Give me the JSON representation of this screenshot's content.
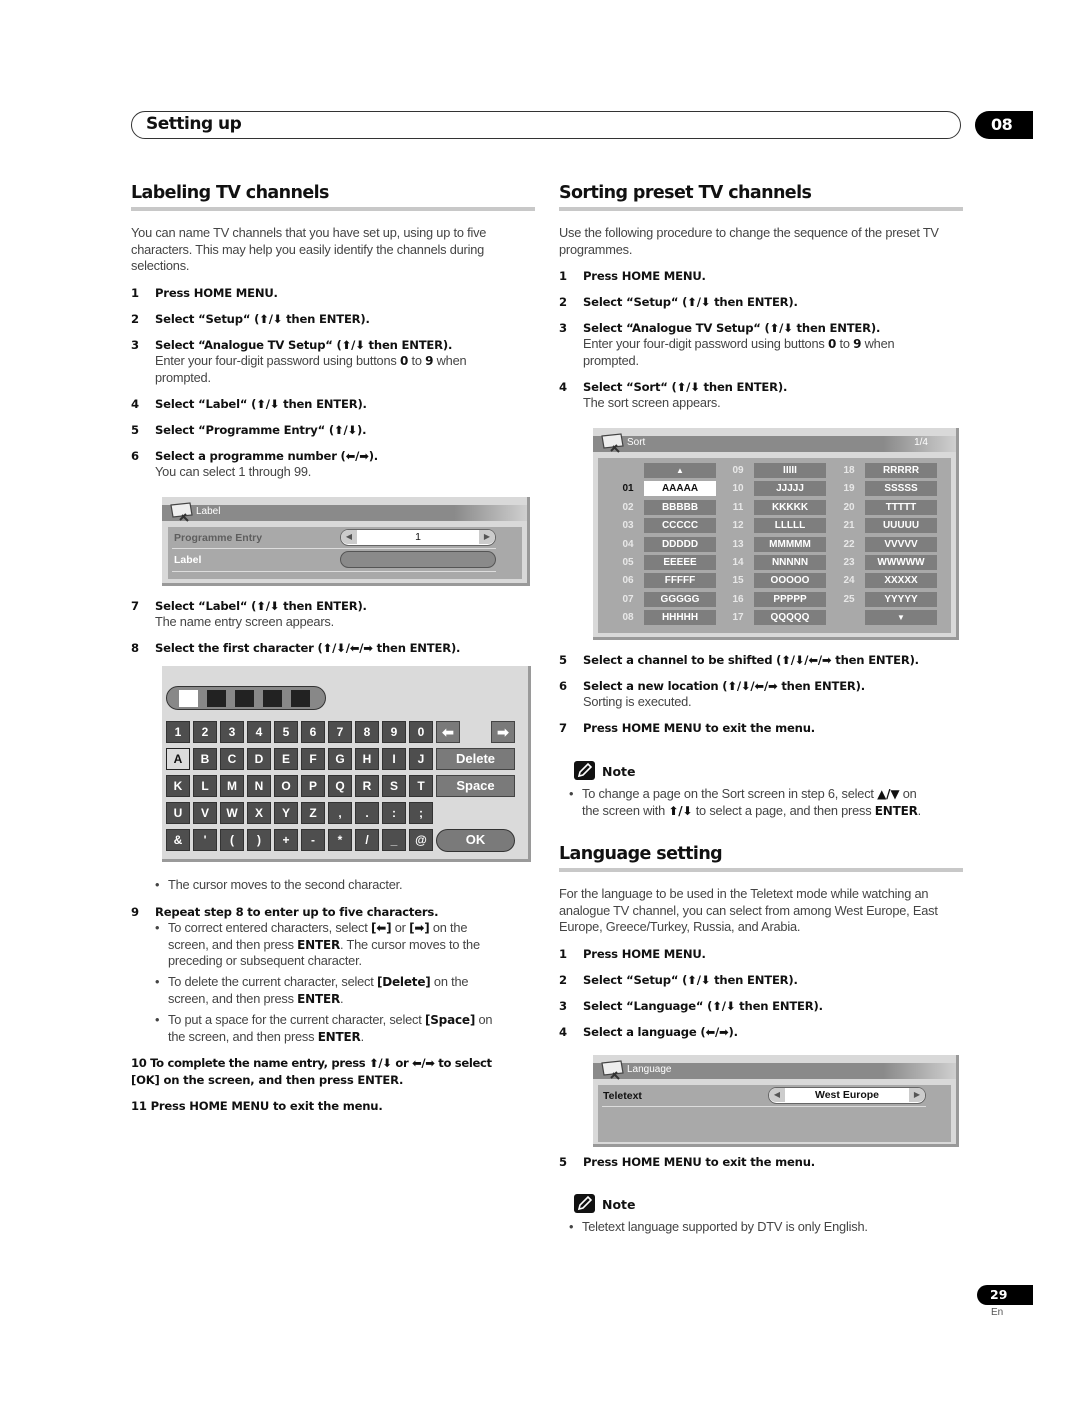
{
  "header": {
    "section_title": "Setting up",
    "chapter_number": "08"
  },
  "labeling": {
    "title": "Labeling TV channels",
    "intro": "You can name TV channels that you have set up, using up to five characters. This may help you easily identify the channels during selections.",
    "steps": [
      {
        "n": "1",
        "text": "Press HOME MENU."
      },
      {
        "n": "2",
        "text": "Select “Setup“ (⬆/⬇ then ENTER)."
      },
      {
        "n": "3",
        "text": "Select “Analogue TV Setup“ (⬆/⬇ then ENTER)."
      },
      {
        "n": "4",
        "text": "Select “Label“ (⬆/⬇ then ENTER)."
      },
      {
        "n": "5",
        "text": "Select “Programme Entry“ (⬆/⬇)."
      },
      {
        "n": "6",
        "text": "Select a programme number (⬅/➡)."
      },
      {
        "n": "7",
        "text": "Select “Label“ (⬆/⬇ then ENTER)."
      },
      {
        "n": "8",
        "text": "Select the first character (⬆/⬇/⬅/➡ then ENTER)."
      },
      {
        "n": "9",
        "text": "Repeat step 8 to enter up to five characters."
      },
      {
        "n": "10",
        "text": "To complete the name entry, press ⬆/⬇ or ⬅/➡ to select"
      },
      {
        "n": "",
        "text": "[OK] on the screen, and then press ENTER."
      },
      {
        "n": "11",
        "text": "Press HOME MENU to exit the menu."
      }
    ],
    "step3_sub_a": "Enter your four-digit password using buttons ",
    "step3_sub_b": "0",
    "step3_sub_c": " to ",
    "step3_sub_d": "9",
    "step3_sub_e": " when",
    "step3_sub_f": "prompted.",
    "step6_sub": "You can select 1 through 99.",
    "step7_sub": "The name entry screen appears.",
    "step8_bullet": "The cursor moves to the second character.",
    "step9_bullets": [
      {
        "a": "To correct entered characters, select ",
        "b": "[⬅]",
        "c": " or ",
        "d": "[➡]",
        "e": " on the",
        "l2a": "screen, and then press ",
        "l2b": "ENTER",
        "l2c": ". The cursor moves to the",
        "l3": "preceding or subsequent character."
      },
      {
        "a": "To delete the current character, select ",
        "b": "[Delete]",
        "c": " on the",
        "l2a": "screen, and then press ",
        "l2b": "ENTER",
        "l2c": "."
      },
      {
        "a": "To put a space for the current character, select ",
        "b": "[Space]",
        "c": " on",
        "l2a": "the screen, and then press ",
        "l2b": "ENTER",
        "l2c": "."
      }
    ],
    "label_screen": {
      "title": "Label",
      "rows": [
        {
          "label": "Programme Entry",
          "value": "1"
        },
        {
          "label": "Label",
          "value": ""
        }
      ]
    },
    "keyboard": {
      "char_slots": 5,
      "active_slot": 0,
      "rows": [
        [
          "1",
          "2",
          "3",
          "4",
          "5",
          "6",
          "7",
          "8",
          "9",
          "0"
        ],
        [
          "A",
          "B",
          "C",
          "D",
          "E",
          "F",
          "G",
          "H",
          "I",
          "J"
        ],
        [
          "K",
          "L",
          "M",
          "N",
          "O",
          "P",
          "Q",
          "R",
          "S",
          "T"
        ],
        [
          "U",
          "V",
          "W",
          "X",
          "Y",
          "Z",
          ",",
          ".",
          ":",
          ";"
        ],
        [
          "&",
          "'",
          "(",
          ")",
          "+",
          "-",
          "*",
          "/",
          "_",
          "@"
        ]
      ],
      "selected_key": "A",
      "left_arrow": "🡄",
      "right_arrow": "🡆",
      "delete_label": "Delete",
      "space_label": "Space",
      "ok_label": "OK"
    }
  },
  "sorting": {
    "title": "Sorting preset TV channels",
    "intro": "Use the following procedure to change the sequence of the preset TV programmes.",
    "steps": [
      {
        "n": "1",
        "text": "Press HOME MENU."
      },
      {
        "n": "2",
        "text": "Select “Setup“ (⬆/⬇ then ENTER)."
      },
      {
        "n": "3",
        "text": "Select “Analogue TV Setup“ (⬆/⬇ then ENTER)."
      },
      {
        "n": "4",
        "text": "Select “Sort“ (⬆/⬇ then ENTER)."
      },
      {
        "n": "5",
        "text": "Select a channel to be shifted (⬆/⬇/⬅/➡ then ENTER)."
      },
      {
        "n": "6",
        "text": "Select a new location (⬆/⬇/⬅/➡ then ENTER)."
      },
      {
        "n": "7",
        "text": "Press HOME MENU to exit the menu."
      }
    ],
    "step3_sub_a": "Enter your four-digit password using buttons ",
    "step3_sub_b": "0",
    "step3_sub_c": " to ",
    "step3_sub_d": "9",
    "step3_sub_e": " when",
    "step3_sub_f": "prompted.",
    "step4_sub": "The sort screen appears.",
    "step6_sub": "Sorting is executed.",
    "sort_screen": {
      "title": "Sort",
      "page": "1/4",
      "up_arrow": "▲",
      "down_arrow": "▼",
      "columns": [
        [
          {
            "num": "",
            "name": "▲"
          },
          {
            "num": "01",
            "name": "AAAAA",
            "selected": true
          },
          {
            "num": "02",
            "name": "BBBBB"
          },
          {
            "num": "03",
            "name": "CCCCC"
          },
          {
            "num": "04",
            "name": "DDDDD"
          },
          {
            "num": "05",
            "name": "EEEEE"
          },
          {
            "num": "06",
            "name": "FFFFF"
          },
          {
            "num": "07",
            "name": "GGGGG"
          },
          {
            "num": "08",
            "name": "HHHHH"
          }
        ],
        [
          {
            "num": "09",
            "name": "IIIII"
          },
          {
            "num": "10",
            "name": "JJJJJ"
          },
          {
            "num": "11",
            "name": "KKKKK"
          },
          {
            "num": "12",
            "name": "LLLLL"
          },
          {
            "num": "13",
            "name": "MMMMM"
          },
          {
            "num": "14",
            "name": "NNNNN"
          },
          {
            "num": "15",
            "name": "OOOOO"
          },
          {
            "num": "16",
            "name": "PPPPP"
          },
          {
            "num": "17",
            "name": "QQQQQ"
          }
        ],
        [
          {
            "num": "18",
            "name": "RRRRR"
          },
          {
            "num": "19",
            "name": "SSSSS"
          },
          {
            "num": "20",
            "name": "TTTTT"
          },
          {
            "num": "21",
            "name": "UUUUU"
          },
          {
            "num": "22",
            "name": "VVVVV"
          },
          {
            "num": "23",
            "name": "WWWWW"
          },
          {
            "num": "24",
            "name": "XXXXX"
          },
          {
            "num": "25",
            "name": "YYYYY"
          },
          {
            "num": "",
            "name": "▼"
          }
        ]
      ]
    },
    "note": {
      "heading": "Note",
      "l1a": "To change a page on the Sort screen in step 6, select ",
      "l1b": "▲/▼",
      "l1c": " on",
      "l2a": "the screen with ",
      "l2b": "⬆/⬇",
      "l2c": " to select a page, and then press ",
      "l2d": "ENTER",
      "l2e": "."
    }
  },
  "language": {
    "title": "Language setting",
    "intro": "For the language to be used in the Teletext mode while watching an analogue TV channel, you can select from among West Europe, East Europe, Greece/Turkey, Russia, and Arabia.",
    "steps": [
      {
        "n": "1",
        "text": "Press HOME MENU."
      },
      {
        "n": "2",
        "text": "Select “Setup“ (⬆/⬇ then ENTER)."
      },
      {
        "n": "3",
        "text": "Select “Language“ (⬆/⬇ then ENTER)."
      },
      {
        "n": "4",
        "text": "Select a language (⬅/➡)."
      },
      {
        "n": "5",
        "text": "Press HOME MENU to exit the menu."
      }
    ],
    "language_screen": {
      "title": "Language",
      "row_label": "Teletext",
      "row_value": "West Europe"
    },
    "note": {
      "heading": "Note",
      "text": "Teletext language supported by DTV is only English."
    }
  },
  "footer": {
    "page_number": "29",
    "language_code": "En"
  }
}
